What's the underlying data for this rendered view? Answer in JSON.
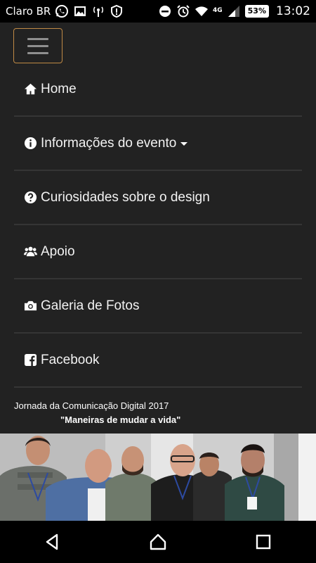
{
  "status_bar": {
    "carrier": "Claro BR",
    "network": "4G",
    "battery": "53%",
    "time": "13:02"
  },
  "menu": {
    "items": [
      {
        "label": "Home",
        "icon": "home-icon"
      },
      {
        "label": "Informações do evento",
        "icon": "info-circle-icon",
        "dropdown": true
      },
      {
        "label": "Curiosidades sobre o design",
        "icon": "question-circle-icon"
      },
      {
        "label": "Apoio",
        "icon": "users-icon"
      },
      {
        "label": "Galeria de Fotos",
        "icon": "camera-icon"
      },
      {
        "label": "Facebook",
        "icon": "facebook-square-icon"
      }
    ]
  },
  "footer": {
    "event": "Jornada da Comunicação Digital 2017",
    "tagline": "\"Maneiras de mudar a vida\""
  },
  "colors": {
    "navbar_bg": "#222222",
    "divider": "#353535",
    "toggler_border": "#c08a45"
  }
}
